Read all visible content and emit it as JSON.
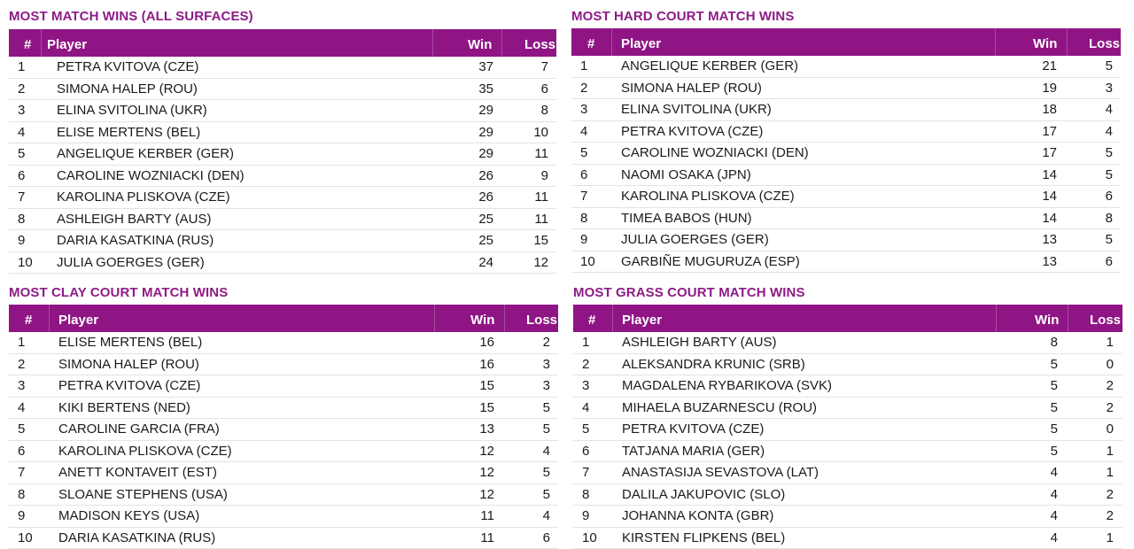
{
  "columns": {
    "rank": "#",
    "player": "Player",
    "win": "Win",
    "loss": "Loss"
  },
  "accent_color": "#8f1585",
  "tables": [
    {
      "title": "MOST MATCH WINS (ALL SURFACES)",
      "rows": [
        {
          "rank": "1",
          "player": "PETRA KVITOVA (CZE)",
          "win": "37",
          "loss": "7"
        },
        {
          "rank": "2",
          "player": "SIMONA HALEP (ROU)",
          "win": "35",
          "loss": "6"
        },
        {
          "rank": "3",
          "player": "ELINA SVITOLINA (UKR)",
          "win": "29",
          "loss": "8"
        },
        {
          "rank": "4",
          "player": "ELISE MERTENS (BEL)",
          "win": "29",
          "loss": "10"
        },
        {
          "rank": "5",
          "player": "ANGELIQUE KERBER (GER)",
          "win": "29",
          "loss": "11"
        },
        {
          "rank": "6",
          "player": "CAROLINE WOZNIACKI (DEN)",
          "win": "26",
          "loss": "9"
        },
        {
          "rank": "7",
          "player": "KAROLINA PLISKOVA (CZE)",
          "win": "26",
          "loss": "11"
        },
        {
          "rank": "8",
          "player": "ASHLEIGH BARTY (AUS)",
          "win": "25",
          "loss": "11"
        },
        {
          "rank": "9",
          "player": "DARIA KASATKINA (RUS)",
          "win": "25",
          "loss": "15"
        },
        {
          "rank": "10",
          "player": "JULIA GOERGES (GER)",
          "win": "24",
          "loss": "12"
        }
      ]
    },
    {
      "title": "MOST HARD COURT MATCH WINS",
      "rows": [
        {
          "rank": "1",
          "player": "ANGELIQUE KERBER (GER)",
          "win": "21",
          "loss": "5"
        },
        {
          "rank": "2",
          "player": "SIMONA HALEP (ROU)",
          "win": "19",
          "loss": "3"
        },
        {
          "rank": "3",
          "player": "ELINA SVITOLINA (UKR)",
          "win": "18",
          "loss": "4"
        },
        {
          "rank": "4",
          "player": "PETRA KVITOVA (CZE)",
          "win": "17",
          "loss": "4"
        },
        {
          "rank": "5",
          "player": "CAROLINE WOZNIACKI (DEN)",
          "win": "17",
          "loss": "5"
        },
        {
          "rank": "6",
          "player": "NAOMI OSAKA (JPN)",
          "win": "14",
          "loss": "5"
        },
        {
          "rank": "7",
          "player": "KAROLINA PLISKOVA (CZE)",
          "win": "14",
          "loss": "6"
        },
        {
          "rank": "8",
          "player": "TIMEA BABOS (HUN)",
          "win": "14",
          "loss": "8"
        },
        {
          "rank": "9",
          "player": "JULIA GOERGES (GER)",
          "win": "13",
          "loss": "5"
        },
        {
          "rank": "10",
          "player": "GARBIÑE MUGURUZA (ESP)",
          "win": "13",
          "loss": "6"
        }
      ]
    },
    {
      "title": "MOST CLAY COURT MATCH WINS",
      "rows": [
        {
          "rank": "1",
          "player": "ELISE MERTENS (BEL)",
          "win": "16",
          "loss": "2"
        },
        {
          "rank": "2",
          "player": "SIMONA HALEP (ROU)",
          "win": "16",
          "loss": "3"
        },
        {
          "rank": "3",
          "player": "PETRA KVITOVA (CZE)",
          "win": "15",
          "loss": "3"
        },
        {
          "rank": "4",
          "player": "KIKI BERTENS (NED)",
          "win": "15",
          "loss": "5"
        },
        {
          "rank": "5",
          "player": "CAROLINE GARCIA (FRA)",
          "win": "13",
          "loss": "5"
        },
        {
          "rank": "6",
          "player": "KAROLINA PLISKOVA (CZE)",
          "win": "12",
          "loss": "4"
        },
        {
          "rank": "7",
          "player": "ANETT KONTAVEIT (EST)",
          "win": "12",
          "loss": "5"
        },
        {
          "rank": "8",
          "player": "SLOANE STEPHENS (USA)",
          "win": "12",
          "loss": "5"
        },
        {
          "rank": "9",
          "player": "MADISON KEYS (USA)",
          "win": "11",
          "loss": "4"
        },
        {
          "rank": "10",
          "player": "DARIA KASATKINA (RUS)",
          "win": "11",
          "loss": "6"
        }
      ]
    },
    {
      "title": "MOST GRASS COURT MATCH WINS",
      "rows": [
        {
          "rank": "1",
          "player": "ASHLEIGH BARTY (AUS)",
          "win": "8",
          "loss": "1"
        },
        {
          "rank": "2",
          "player": "ALEKSANDRA KRUNIC (SRB)",
          "win": "5",
          "loss": "0"
        },
        {
          "rank": "3",
          "player": "MAGDALENA RYBARIKOVA (SVK)",
          "win": "5",
          "loss": "2"
        },
        {
          "rank": "4",
          "player": "MIHAELA BUZARNESCU (ROU)",
          "win": "5",
          "loss": "2"
        },
        {
          "rank": "5",
          "player": "PETRA KVITOVA (CZE)",
          "win": "5",
          "loss": "0"
        },
        {
          "rank": "6",
          "player": "TATJANA MARIA (GER)",
          "win": "5",
          "loss": "1"
        },
        {
          "rank": "7",
          "player": "ANASTASIJA SEVASTOVA (LAT)",
          "win": "4",
          "loss": "1"
        },
        {
          "rank": "8",
          "player": "DALILA JAKUPOVIC (SLO)",
          "win": "4",
          "loss": "2"
        },
        {
          "rank": "9",
          "player": "JOHANNA KONTA (GBR)",
          "win": "4",
          "loss": "2"
        },
        {
          "rank": "10",
          "player": "KIRSTEN FLIPKENS (BEL)",
          "win": "4",
          "loss": "1"
        }
      ]
    }
  ]
}
